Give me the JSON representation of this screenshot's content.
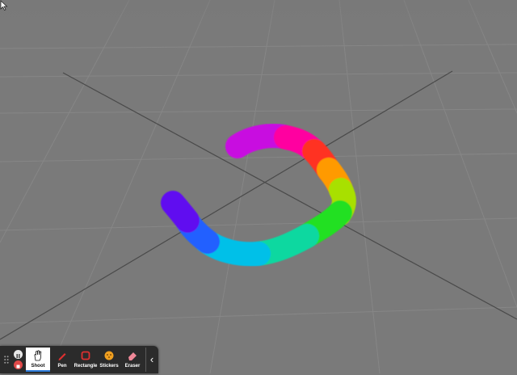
{
  "toolbar": {
    "tools": [
      {
        "label": "Shoot",
        "icon": "hand-icon",
        "active": true
      },
      {
        "label": "Pen",
        "icon": "pen-icon"
      },
      {
        "label": "Rectangle",
        "icon": "rectangle-icon",
        "color": "#e03030"
      },
      {
        "label": "Stickers",
        "icon": "sticker-icon",
        "color": "#f0a020"
      },
      {
        "label": "Eraser",
        "icon": "eraser-icon",
        "color": "#f08898"
      }
    ],
    "collapse_glyph": "‹"
  },
  "scene": {
    "background": "#7a7a7a",
    "grid_color": "#8c8c8c",
    "axis_color": "#4a4a4a",
    "stroke": "rainbow"
  }
}
